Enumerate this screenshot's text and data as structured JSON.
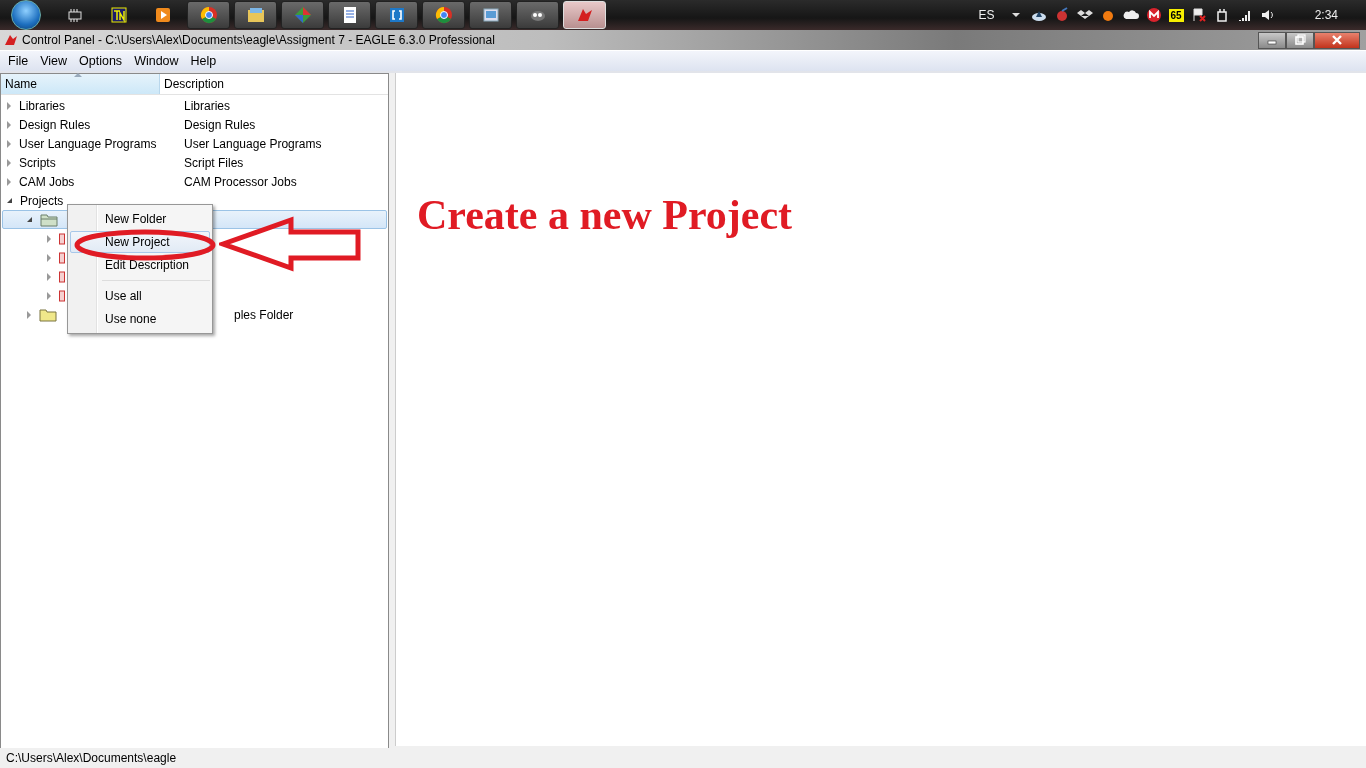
{
  "taskbar": {
    "apps": [
      {
        "kind": "chip",
        "active": false
      },
      {
        "kind": "tn",
        "active": false
      },
      {
        "kind": "player",
        "active": false
      },
      {
        "kind": "chrome",
        "active": false
      },
      {
        "kind": "explorer",
        "active": false
      },
      {
        "kind": "diamond",
        "active": false
      },
      {
        "kind": "document",
        "active": false
      },
      {
        "kind": "bracket",
        "active": false
      },
      {
        "kind": "chrome",
        "active": false
      },
      {
        "kind": "picture",
        "active": false
      },
      {
        "kind": "gimp",
        "active": false
      },
      {
        "kind": "eagle",
        "active": true
      }
    ],
    "tray": {
      "language": "ES",
      "badge": "65",
      "clock": "2:34"
    }
  },
  "window": {
    "title": "Control Panel - C:\\Users\\Alex\\Documents\\eagle\\Assigment 7 - EAGLE 6.3.0 Professional"
  },
  "menu": [
    "File",
    "View",
    "Options",
    "Window",
    "Help"
  ],
  "tree": {
    "columns": [
      "Name",
      "Description"
    ],
    "rows": [
      {
        "kind": "category",
        "label": "Libraries",
        "description": "Libraries",
        "expanded": false,
        "selected": false
      },
      {
        "kind": "category",
        "label": "Design Rules",
        "description": "Design Rules",
        "expanded": false,
        "selected": false
      },
      {
        "kind": "category",
        "label": "User Language Programs",
        "description": "User Language Programs",
        "expanded": false,
        "selected": false
      },
      {
        "kind": "category",
        "label": "Scripts",
        "description": "Script Files",
        "expanded": false,
        "selected": false
      },
      {
        "kind": "category",
        "label": "CAM Jobs",
        "description": "CAM Processor Jobs",
        "expanded": false,
        "selected": false
      },
      {
        "kind": "category",
        "label": "Projects",
        "expanded": true,
        "selected": false,
        "children": [
          {
            "kind": "folder",
            "expanded": true,
            "selected": true,
            "children": [
              {
                "kind": "project",
                "expanded": false,
                "selected": false
              },
              {
                "kind": "project",
                "expanded": false,
                "selected": false
              },
              {
                "kind": "project",
                "expanded": false,
                "selected": false
              },
              {
                "kind": "project",
                "expanded": false,
                "selected": false
              }
            ]
          },
          {
            "kind": "folder",
            "description": "ples Folder",
            "expanded": false,
            "selected": false
          }
        ]
      }
    ]
  },
  "context_menu": [
    {
      "kind": "item",
      "label": "New Folder",
      "selected": false
    },
    {
      "kind": "item",
      "label": "New Project",
      "selected": true
    },
    {
      "kind": "item",
      "label": "Edit Description",
      "selected": false
    },
    {
      "kind": "separator"
    },
    {
      "kind": "item",
      "label": "Use all",
      "selected": false
    },
    {
      "kind": "item",
      "label": "Use none",
      "selected": false
    }
  ],
  "annotation": {
    "text": "Create a new Project"
  },
  "status_bar": {
    "path": "C:\\Users\\Alex\\Documents\\eagle"
  }
}
